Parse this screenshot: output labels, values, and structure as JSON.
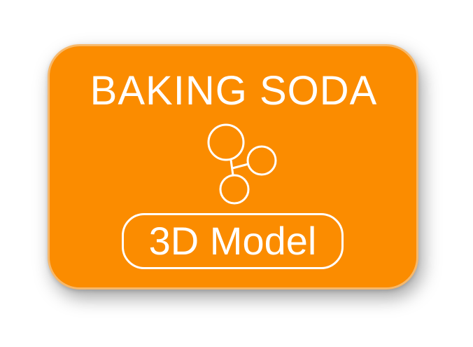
{
  "card": {
    "title": "BAKING SODA",
    "icon": "molecule-icon",
    "button_label": "3D Model"
  },
  "colors": {
    "card_fill": "#fb8c00",
    "card_border": "#f7b86a",
    "foreground": "#ffffff",
    "background": "#ffffff"
  }
}
